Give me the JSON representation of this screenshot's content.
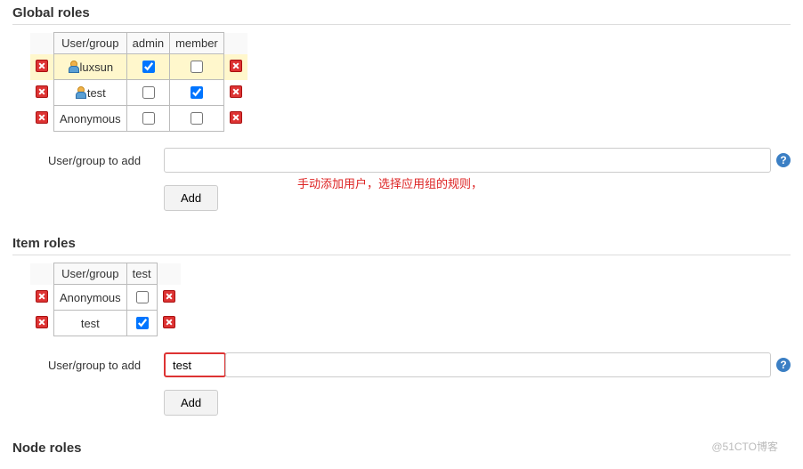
{
  "sections": {
    "global": {
      "title": "Global roles",
      "headers": [
        "User/group",
        "admin",
        "member"
      ],
      "rows": [
        {
          "name": "luxsun",
          "hasIcon": true,
          "admin": true,
          "member": false,
          "highlight": true
        },
        {
          "name": "test",
          "hasIcon": true,
          "admin": false,
          "member": true,
          "highlight": false
        },
        {
          "name": "Anonymous",
          "hasIcon": false,
          "admin": false,
          "member": false,
          "highlight": false
        }
      ],
      "form_label": "User/group to add",
      "form_value": "",
      "add_label": "Add"
    },
    "item": {
      "title": "Item roles",
      "headers": [
        "User/group",
        "test"
      ],
      "rows": [
        {
          "name": "Anonymous",
          "hasIcon": false,
          "test": false
        },
        {
          "name": "test",
          "hasIcon": false,
          "test": true
        }
      ],
      "form_label": "User/group to add",
      "form_value": "test",
      "add_label": "Add"
    },
    "node": {
      "title": "Node roles"
    }
  },
  "annotation": "手动添加用户，选择应用组的规则，",
  "watermark": "@51CTO博客",
  "help_glyph": "?"
}
